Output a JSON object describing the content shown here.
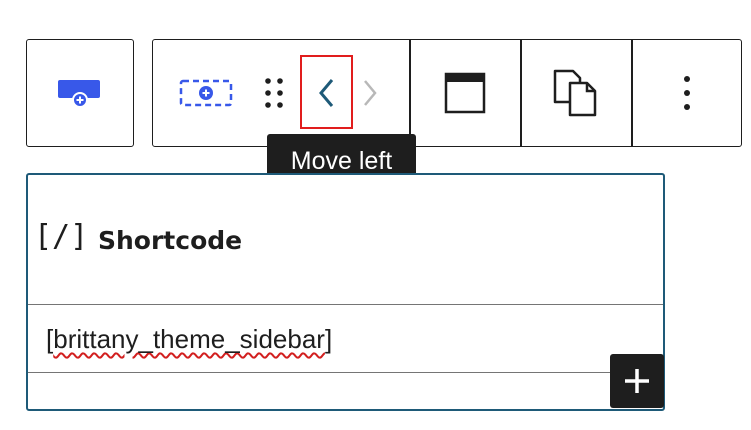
{
  "tooltip": {
    "text": "Move left"
  },
  "block": {
    "title": "Shortcode",
    "icon_glyph": "[/]",
    "input_prefix": "[",
    "input_word": "brittany_theme_sidebar",
    "input_suffix": "]"
  },
  "icons": {
    "parent": "select-parent-icon",
    "block_type": "shortcode-block-icon",
    "drag": "drag-handle-icon",
    "move_left": "chevron-left-icon",
    "move_right": "chevron-right-icon",
    "align": "align-full-icon",
    "duplicate": "duplicate-icon",
    "more": "more-vertical-icon",
    "add": "plus-icon"
  },
  "colors": {
    "accent": "#3858e9",
    "teal": "#1e5a78",
    "highlight": "#e11d1d"
  }
}
